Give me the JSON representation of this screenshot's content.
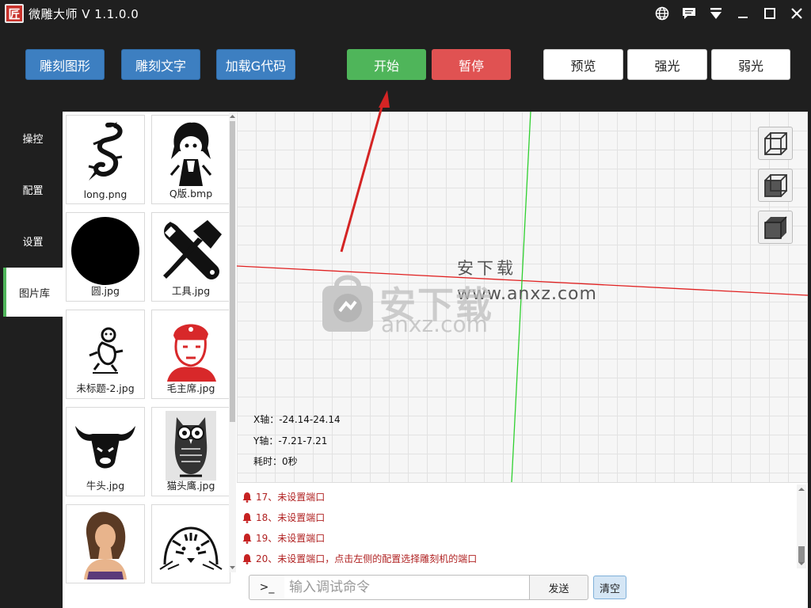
{
  "window": {
    "logo_char": "匠",
    "title": "微雕大师 V 1.1.0.0",
    "controls": [
      "globe-icon",
      "chat-icon",
      "dropdown-icon",
      "minimize-icon",
      "maximize-icon",
      "close-icon"
    ]
  },
  "toolbar": {
    "engrave_shape": "雕刻图形",
    "engrave_text": "雕刻文字",
    "load_gcode": "加载G代码",
    "start": "开始",
    "pause": "暂停",
    "preview": "预览",
    "strong_light": "强光",
    "weak_light": "弱光"
  },
  "left_tabs": [
    {
      "label": "操控"
    },
    {
      "label": "配置"
    },
    {
      "label": "设置"
    },
    {
      "label": "图片库",
      "active": true
    }
  ],
  "gallery": {
    "items": [
      {
        "caption": "long.png",
        "icon": "dragon-image"
      },
      {
        "caption": "Q版.bmp",
        "icon": "anime-girl-image"
      },
      {
        "caption": "圆.jpg",
        "icon": "circle-image"
      },
      {
        "caption": "工具.jpg",
        "icon": "tools-image"
      },
      {
        "caption": "未标题-2.jpg",
        "icon": "monkey-image"
      },
      {
        "caption": "毛主席.jpg",
        "icon": "portrait-image"
      },
      {
        "caption": "牛头.jpg",
        "icon": "bull-head-image"
      },
      {
        "caption": "猫头鹰.jpg",
        "icon": "owl-image"
      },
      {
        "caption": "",
        "icon": "woman-photo-image"
      },
      {
        "caption": "",
        "icon": "tiger-image"
      }
    ]
  },
  "canvas": {
    "x_axis": "X轴：-24.14-24.14",
    "y_axis": "Y轴：-7.21-7.21",
    "elapsed": "耗时：0秒",
    "watermark_small": "安下载",
    "watermark_small_url": "www.anxz.com",
    "watermark_big": "安下载",
    "watermark_big_url": "anxz.com",
    "view_buttons": [
      "wireframe-cube-icon",
      "half-solid-cube-icon",
      "solid-cube-icon"
    ]
  },
  "log": {
    "lines": [
      "17、未设置端口",
      "18、未设置端口",
      "19、未设置端口",
      "20、未设置端口，点击左侧的配置选择雕刻机的端口"
    ]
  },
  "command": {
    "prompt": ">_",
    "placeholder": "输入调试命令",
    "value": "",
    "send": "发送",
    "clear": "清空"
  },
  "colors": {
    "accent_blue": "#3d7fc1",
    "start_green": "#4fb55a",
    "pause_red": "#e05252",
    "log_red": "#b02222",
    "x_axis_line": "#e02020",
    "y_axis_line": "#30d030"
  }
}
